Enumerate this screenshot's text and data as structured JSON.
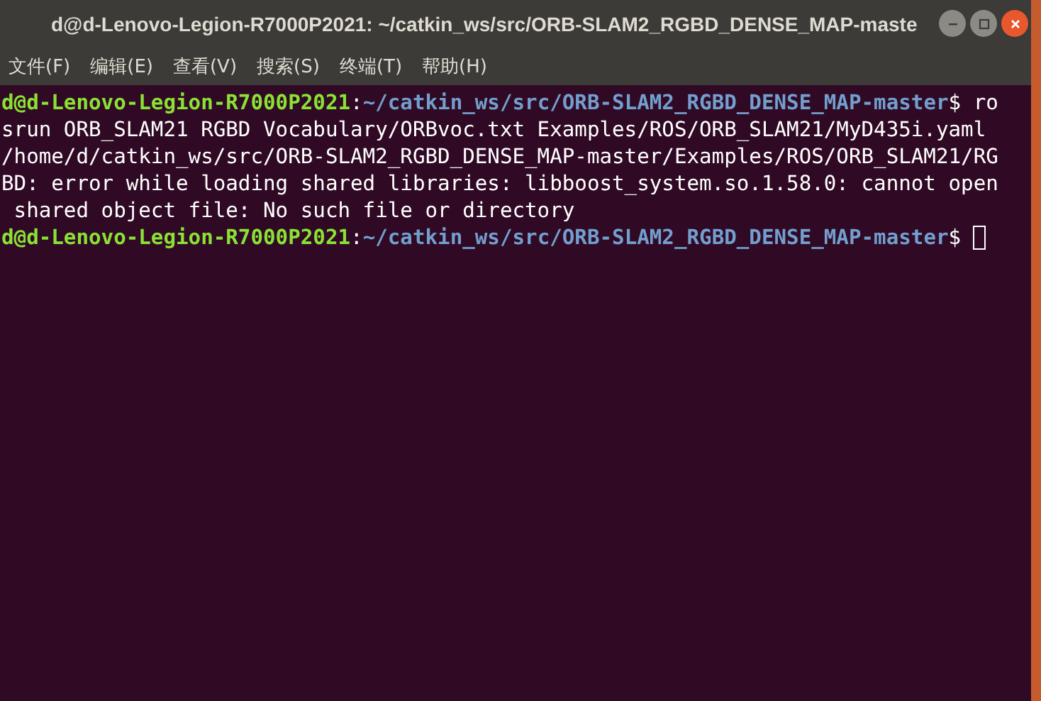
{
  "window": {
    "title": "d@d-Lenovo-Legion-R7000P2021: ~/catkin_ws/src/ORB-SLAM2_RGBD_DENSE_MAP-maste"
  },
  "menu": [
    {
      "label": "文件(F)"
    },
    {
      "label": "编辑(E)"
    },
    {
      "label": "查看(V)"
    },
    {
      "label": "搜索(S)"
    },
    {
      "label": "终端(T)"
    },
    {
      "label": "帮助(H)"
    }
  ],
  "terminal": {
    "cursor": true,
    "lines": [
      {
        "segments": [
          {
            "kind": "user",
            "text": "d@d-Lenovo-Legion-R7000P2021"
          },
          {
            "kind": "plain",
            "text": ":"
          },
          {
            "kind": "path",
            "text": "~/catkin_ws/src/ORB-SLAM2_RGBD_DENSE_MAP-master"
          },
          {
            "kind": "plain",
            "text": "$ ro"
          }
        ]
      },
      {
        "segments": [
          {
            "kind": "plain",
            "text": "srun ORB_SLAM21 RGBD Vocabulary/ORBvoc.txt Examples/ROS/ORB_SLAM21/MyD435i.yaml"
          }
        ]
      },
      {
        "segments": [
          {
            "kind": "plain",
            "text": "/home/d/catkin_ws/src/ORB-SLAM2_RGBD_DENSE_MAP-master/Examples/ROS/ORB_SLAM21/RG"
          }
        ]
      },
      {
        "segments": [
          {
            "kind": "plain",
            "text": "BD: error while loading shared libraries: libboost_system.so.1.58.0: cannot open"
          }
        ]
      },
      {
        "segments": [
          {
            "kind": "plain",
            "text": " shared object file: No such file or directory"
          }
        ]
      },
      {
        "segments": [
          {
            "kind": "user",
            "text": "d@d-Lenovo-Legion-R7000P2021"
          },
          {
            "kind": "plain",
            "text": ":"
          },
          {
            "kind": "path",
            "text": "~/catkin_ws/src/ORB-SLAM2_RGBD_DENSE_MAP-master"
          },
          {
            "kind": "plain",
            "text": "$ "
          }
        ]
      }
    ]
  }
}
